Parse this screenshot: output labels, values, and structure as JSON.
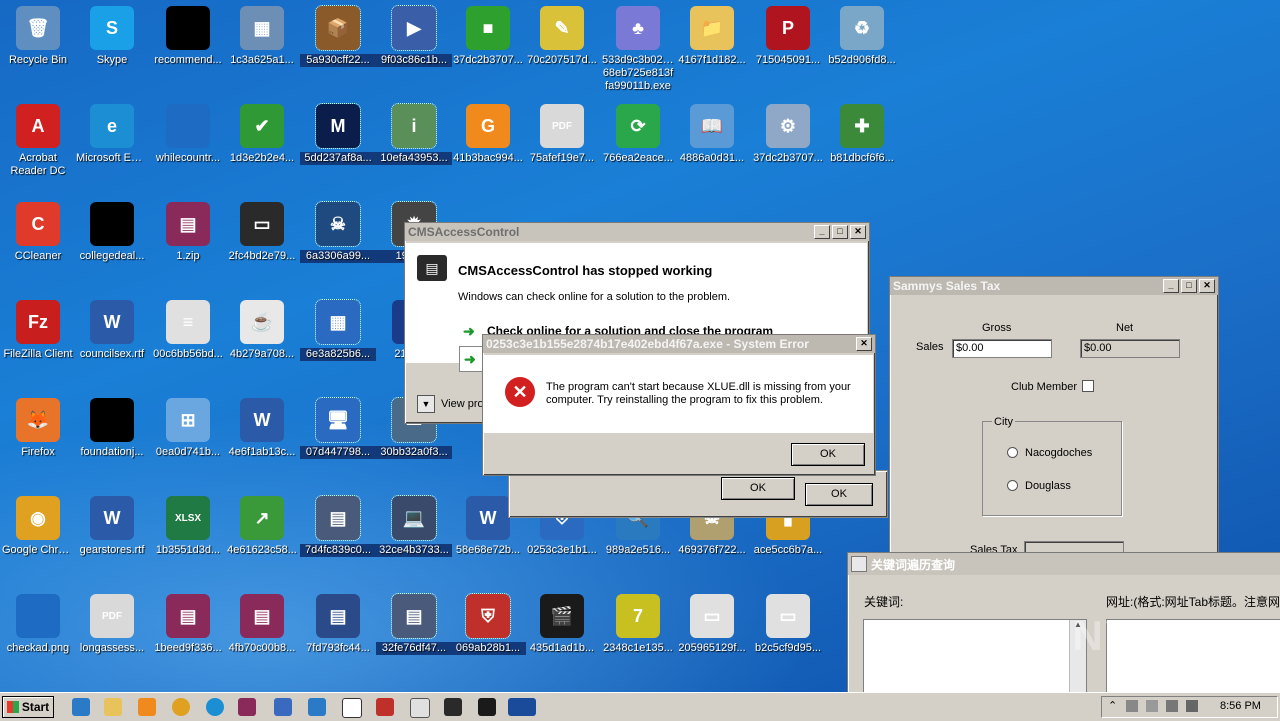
{
  "desktop": {
    "icons": [
      {
        "label": "Recycle Bin",
        "glyph": "🗑",
        "color": "#5f8fc0"
      },
      {
        "label": "Skype",
        "glyph": "S",
        "color": "#1aa0e6"
      },
      {
        "label": "recommend...",
        "glyph": "",
        "color": "#000000"
      },
      {
        "label": "1c3a625a1...",
        "glyph": "▦",
        "color": "#6d8fb5"
      },
      {
        "label": "5a930cff22...",
        "glyph": "📦",
        "color": "#8a5a2a"
      },
      {
        "label": "9f03c86c1b...",
        "glyph": "▶",
        "color": "#3a5fa8"
      },
      {
        "label": "37dc2b3707...",
        "glyph": "■",
        "color": "#2ea02e"
      },
      {
        "label": "70c207517d...",
        "glyph": "✎",
        "color": "#d9c23a"
      },
      {
        "label": "533d9c3b0206 68eb725e813f fa99011b.exe",
        "glyph": "♣",
        "color": "#7a7ad6"
      },
      {
        "label": "4167f1d182...",
        "glyph": "📁",
        "color": "#e8c25a"
      },
      {
        "label": "715045091...",
        "glyph": "P",
        "color": "#b0141e"
      },
      {
        "label": "b52d906fd8...",
        "glyph": "♻",
        "color": "#7aa7c7"
      },
      {
        "label": "Acrobat Reader DC",
        "glyph": "A",
        "color": "#d02020"
      },
      {
        "label": "Microsoft Edge",
        "glyph": "e",
        "color": "#1c8fd4"
      },
      {
        "label": "whilecountr...",
        "glyph": "",
        "color": "#1e6bc4"
      },
      {
        "label": "1d3e2b2e4...",
        "glyph": "✔",
        "color": "#2f9a35"
      },
      {
        "label": "5dd237af8a...",
        "glyph": "M",
        "color": "#0b1d4a"
      },
      {
        "label": "10efa43953...",
        "glyph": "i",
        "color": "#5a8f5a"
      },
      {
        "label": "41b3bac994...",
        "glyph": "G",
        "color": "#f08a1c"
      },
      {
        "label": "75afef19e7...",
        "glyph": "PDF",
        "color": "#d9d9d9"
      },
      {
        "label": "766ea2eace...",
        "glyph": "⟳",
        "color": "#2aa74a"
      },
      {
        "label": "4886a0d31...",
        "glyph": "📖",
        "color": "#5a9ad6"
      },
      {
        "label": "37dc2b3707...",
        "glyph": "⚙",
        "color": "#8fa8c8"
      },
      {
        "label": "b81dbcf6f6...",
        "glyph": "✚",
        "color": "#3a8a3a"
      },
      {
        "label": "CCleaner",
        "glyph": "C",
        "color": "#e03a2a"
      },
      {
        "label": "collegedeal...",
        "glyph": "",
        "color": "#000000"
      },
      {
        "label": "1.zip",
        "glyph": "▤",
        "color": "#8a2a5a"
      },
      {
        "label": "2fc4bd2e79...",
        "glyph": "▭",
        "color": "#2a2a2a"
      },
      {
        "label": "6a3306a99...",
        "glyph": "☠",
        "color": "#1e4a80"
      },
      {
        "label": "19f2b...",
        "glyph": "✹",
        "color": "#444"
      },
      {
        "label": "FileZilla Client",
        "glyph": "Fz",
        "color": "#c81e1e"
      },
      {
        "label": "councilsex.rtf",
        "glyph": "W",
        "color": "#2a5aa8"
      },
      {
        "label": "00c6bb56bd...",
        "glyph": "≡",
        "color": "#e0e0e0"
      },
      {
        "label": "4b279a708...",
        "glyph": "☕",
        "color": "#e8e8e8"
      },
      {
        "label": "6e3a825b6...",
        "glyph": "▦",
        "color": "#2a6ac0"
      },
      {
        "label": "21c32...",
        "glyph": "▩",
        "color": "#1a3a8a"
      },
      {
        "label": "Firefox",
        "glyph": "🦊",
        "color": "#e8742a"
      },
      {
        "label": "foundationj...",
        "glyph": "",
        "color": "#000000"
      },
      {
        "label": "0ea0d741b...",
        "glyph": "⊞",
        "color": "#6aa6e0"
      },
      {
        "label": "4e6f1ab13c...",
        "glyph": "W",
        "color": "#2a5aa8"
      },
      {
        "label": "07d447798...",
        "glyph": "🖥",
        "color": "#2a6ac0"
      },
      {
        "label": "30bb32a0f3...",
        "glyph": "▭",
        "color": "#4a6a8a"
      },
      {
        "label": "Google Chrome",
        "glyph": "◉",
        "color": "#e0a020"
      },
      {
        "label": "gearstores.rtf",
        "glyph": "W",
        "color": "#2a5aa8"
      },
      {
        "label": "1b3551d3d...",
        "glyph": "XLSX",
        "color": "#1f7a44"
      },
      {
        "label": "4e61623c58...",
        "glyph": "↗",
        "color": "#3a9a3a"
      },
      {
        "label": "7d4fc839c0...",
        "glyph": "▤",
        "color": "#4a5a7a"
      },
      {
        "label": "32ce4b3733...",
        "glyph": "💻",
        "color": "#3a4a6a"
      },
      {
        "label": "58e68e72b...",
        "glyph": "W",
        "color": "#2a5aa8"
      },
      {
        "label": "0253c3e1b1...",
        "glyph": "⛨",
        "color": "#2a6ac0"
      },
      {
        "label": "989a2e516...",
        "glyph": "🔍",
        "color": "#2a7ac0"
      },
      {
        "label": "469376f722...",
        "glyph": "☠",
        "color": "#b0a070"
      },
      {
        "label": "ace5cc6b7a...",
        "glyph": "▮",
        "color": "#d8a020"
      },
      {
        "label": "checkad.png",
        "glyph": "",
        "color": "#1e6bc4"
      },
      {
        "label": "longassess...",
        "glyph": "PDF",
        "color": "#d9d9d9"
      },
      {
        "label": "1beed9f336...",
        "glyph": "▤",
        "color": "#8a2a5a"
      },
      {
        "label": "4fb70c00b8...",
        "glyph": "▤",
        "color": "#8a2a5a"
      },
      {
        "label": "7fd793fc44...",
        "glyph": "▤",
        "color": "#2a4a8a"
      },
      {
        "label": "32fe76df47...",
        "glyph": "▤",
        "color": "#4a5a7a"
      },
      {
        "label": "069ab28b1...",
        "glyph": "⛨",
        "color": "#c0302a"
      },
      {
        "label": "435d1ad1b...",
        "glyph": "🎬",
        "color": "#1a1a1a"
      },
      {
        "label": "2348c1e135...",
        "glyph": "7",
        "color": "#c8c020"
      },
      {
        "label": "205965129f...",
        "glyph": "▭",
        "color": "#e0e0e0"
      },
      {
        "label": "b2c5cf9d95...",
        "glyph": "▭",
        "color": "#e0e0e0"
      }
    ]
  },
  "cms_window": {
    "title": "CMSAccessControl",
    "heading": "CMSAccessControl has stopped working",
    "subtext": "Windows can check online for a solution to the problem.",
    "option1": "Check online for a solution and close the program",
    "view_problem": "View pro",
    "ok_label": "OK"
  },
  "error_dialog": {
    "title": "0253c3e1b155e2874b17e402ebd4f67a.exe - System Error",
    "message": "The program can't start because XLUE.dll is missing from your computer. Try reinstalling the program to fix this problem.",
    "ok_label": "OK"
  },
  "behind_ok": {
    "label_a": "OK",
    "label_b": "OK"
  },
  "sales_tax": {
    "title": "Sammys Sales Tax",
    "gross_label": "Gross",
    "net_label": "Net",
    "sales_label": "Sales",
    "sales_value": "$0.00",
    "net_value": "$0.00",
    "club_member": "Club Member",
    "city_group": "City",
    "city_options": [
      "Nacogdoches",
      "Douglass"
    ],
    "sales_tax_label": "Sales Tax"
  },
  "keyword_window": {
    "title": "关键词遍历查询",
    "keyword_label": "关键词:",
    "url_label": "网址:(格式:网址Tab标题。注意网"
  },
  "taskbar": {
    "start_label": "Start",
    "clock": "8:56 PM"
  },
  "watermark": "ANY RUN"
}
